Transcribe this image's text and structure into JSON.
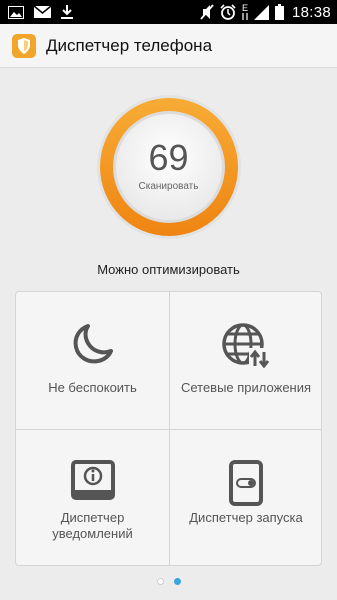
{
  "status_bar": {
    "time": "18:38",
    "left_icons": [
      "image-icon",
      "mail-icon",
      "download-icon"
    ],
    "right_icons": [
      "mute-icon",
      "alarm-icon",
      "network-type-icon",
      "signal-icon",
      "battery-icon"
    ],
    "network_type": "E"
  },
  "app_bar": {
    "title": "Диспетчер телефона",
    "logo_icon": "shield-icon"
  },
  "score": {
    "value": "69",
    "button_label": "Сканировать",
    "ring_color": "#f39a1e"
  },
  "status_message": "Можно оптимизировать",
  "tiles": [
    {
      "label": "Не беспокоить",
      "icon": "moon-icon"
    },
    {
      "label": "Сетевые приложения",
      "icon": "network-globe-icon"
    },
    {
      "label": "Диспетчер уведомлений",
      "icon": "notification-icon"
    },
    {
      "label": "Диспетчер запуска",
      "icon": "startup-toggle-icon"
    }
  ],
  "pager": {
    "page": 2,
    "total": 2
  },
  "colors": {
    "accent": "#f39a1e",
    "indicator_active": "#3aa6e0"
  }
}
